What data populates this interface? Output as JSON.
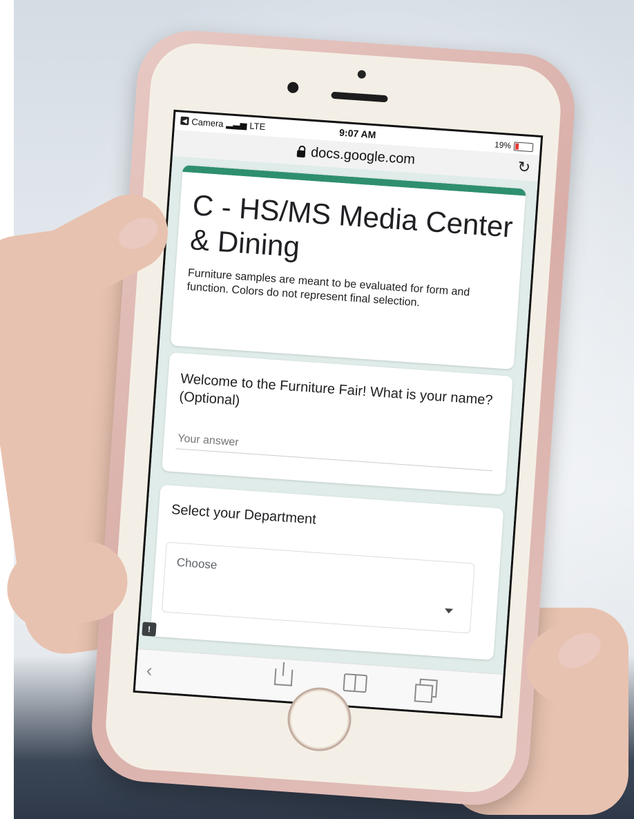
{
  "status_bar": {
    "back_app": "Camera",
    "network": "LTE",
    "time": "9:07 AM",
    "battery": "19%"
  },
  "browser": {
    "url": "docs.google.com"
  },
  "form": {
    "title": "C - HS/MS Media Center & Dining",
    "description": "Furniture samples are meant to be evaluated for form and function. Colors do not represent final selection.",
    "questions": [
      {
        "label": "Welcome to the Furniture Fair! What is your name? (Optional)",
        "placeholder": "Your answer"
      },
      {
        "label": "Select your Department",
        "selected": "Choose"
      }
    ]
  },
  "colors": {
    "accent": "#2e8f6f",
    "form_background": "#dfece9",
    "phone_case": "#e2bbb5"
  }
}
